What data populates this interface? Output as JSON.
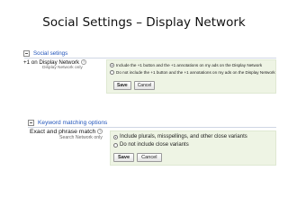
{
  "slide": {
    "title": "Social Settings – Display Network"
  },
  "social": {
    "section_label": "Social setings",
    "setting_name": "+1 on Display Network",
    "setting_sub": "Display Network only",
    "options": [
      {
        "label": "Include the +1 button and the +1 annotations on my ads on the Display Network",
        "selected": true
      },
      {
        "label": "Do not include the +1 button and the +1 annotations on my ads on the Display Network",
        "selected": false
      }
    ],
    "save_label": "Save",
    "cancel_label": "Cancel"
  },
  "keyword": {
    "section_label": "Keyword matching options",
    "setting_name": "Exact and phrase match",
    "setting_sub": "Search Network only",
    "options": [
      {
        "label": "Include plurals, misspellings, and other close variants",
        "selected": true
      },
      {
        "label": "Do not include close variants",
        "selected": false
      }
    ],
    "save_label": "Save",
    "cancel_label": "Cancel"
  },
  "icons": {
    "help": "?"
  },
  "colors": {
    "link": "#2255bb",
    "panel_bg": "#eef4e4",
    "rule": "#cfd6e4"
  }
}
